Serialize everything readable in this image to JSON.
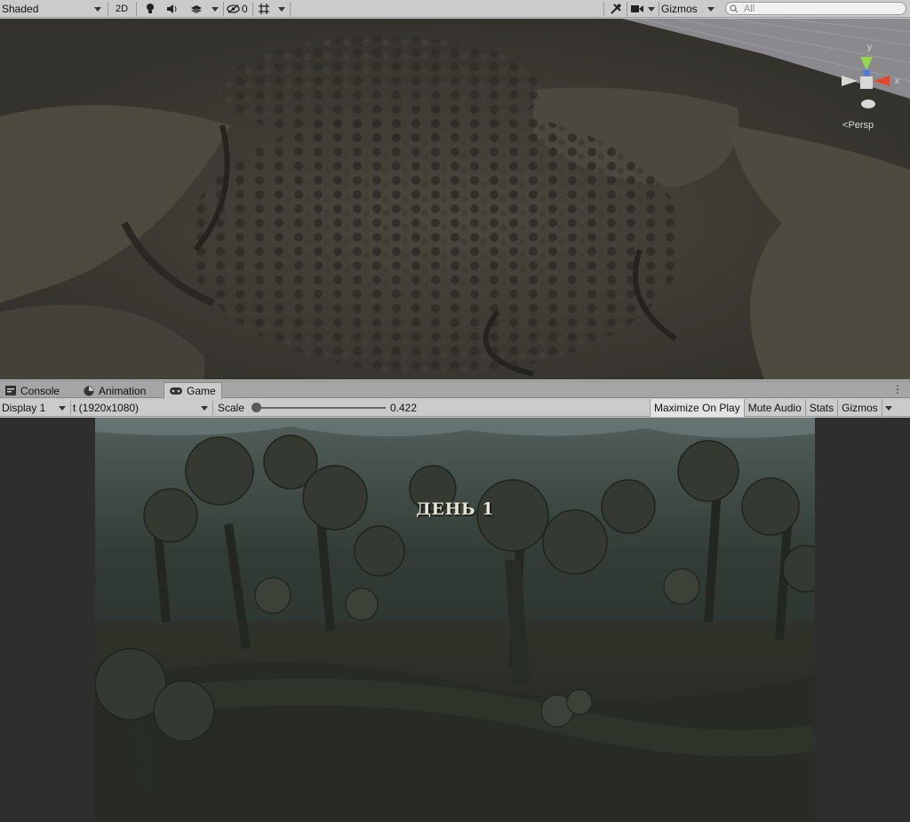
{
  "scene_toolbar": {
    "shading_mode": "Shaded",
    "mode_2d": "2D",
    "hidden_count": "0",
    "gizmos_label": "Gizmos",
    "search_placeholder": "All",
    "icons": [
      "light-bulb-icon",
      "audio-icon",
      "effects-icon",
      "visibility-icon",
      "grid-icon",
      "tools-icon",
      "camera-icon",
      "search-icon"
    ]
  },
  "scene_view": {
    "projection_label": "Persp",
    "gizmo_axes": {
      "y": "y",
      "x": "x"
    },
    "axis_colors": {
      "x": "#e8452c",
      "y": "#8fd94a",
      "z": "#4a7ae8"
    }
  },
  "tabs": [
    {
      "label": "Console",
      "icon": "console-icon"
    },
    {
      "label": "Animation",
      "icon": "animation-icon"
    },
    {
      "label": "Game",
      "icon": "gamepad-icon",
      "active": true
    }
  ],
  "game_toolbar": {
    "display": "Display 1",
    "resolution": "t (1920x1080)",
    "scale_label": "Scale",
    "scale_value": "0.422",
    "maximize_on_play": "Maximize On Play",
    "mute_audio": "Mute Audio",
    "stats": "Stats",
    "gizmos": "Gizmos"
  },
  "game_view": {
    "day_text": "ДЕНЬ 1"
  },
  "colors": {
    "toolbar_bg": "#cbcbcb",
    "tab_bar_bg": "#a5a5a5",
    "scene_bg": "#3f3c35",
    "game_bg": "#2e2e2e"
  }
}
